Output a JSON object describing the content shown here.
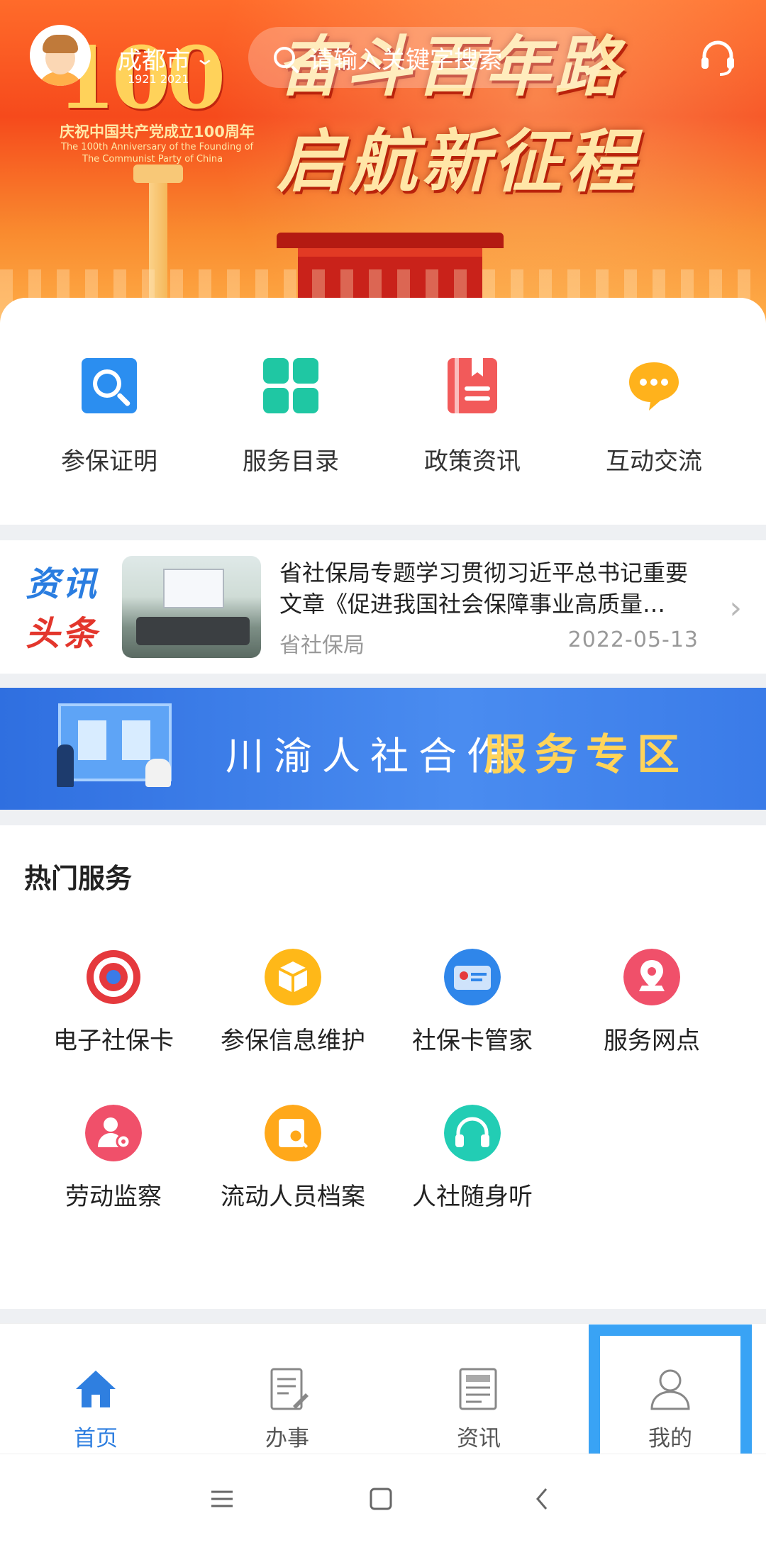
{
  "header": {
    "city": "成都市",
    "search_placeholder": "请输入关键字搜索",
    "slogan_line1": "奋斗百年路",
    "slogan_line2": "启航新征程",
    "logo": {
      "number": "100",
      "years": "1921   2021",
      "line1": "庆祝中国共产党成立100周年",
      "line2": "The 100th Anniversary of the Founding of",
      "line3": "The Communist Party of China"
    }
  },
  "quick_actions": [
    {
      "label": "参保证明",
      "icon": "search-doc-icon",
      "color": "#2b8ef0"
    },
    {
      "label": "服务目录",
      "icon": "grid-icon",
      "color": "#1fc7a3"
    },
    {
      "label": "政策资讯",
      "icon": "book-icon",
      "color": "#f25a5a"
    },
    {
      "label": "互动交流",
      "icon": "chat-icon",
      "color": "#ffb21c"
    }
  ],
  "news": {
    "tag_line1": "资讯",
    "tag_line2": "头条",
    "title": "省社保局专题学习贯彻习近平总书记重要文章《促进我国社会保障事业高质量…",
    "source": "省社保局",
    "date": "2022-05-13"
  },
  "promo": {
    "text_white": "川渝人社合作",
    "text_highlight": "服务专区"
  },
  "hot_services": {
    "title": "热门服务",
    "items": [
      {
        "label": "电子社保卡",
        "icon": "social-security-card-icon",
        "color": "#e5393d"
      },
      {
        "label": "参保信息维护",
        "icon": "box-icon",
        "color": "#ffb818"
      },
      {
        "label": "社保卡管家",
        "icon": "card-icon",
        "color": "#2f86ea"
      },
      {
        "label": "服务网点",
        "icon": "location-icon",
        "color": "#f0506a"
      },
      {
        "label": "劳动监察",
        "icon": "inspection-icon",
        "color": "#f0506a"
      },
      {
        "label": "流动人员档案",
        "icon": "archive-search-icon",
        "color": "#ffa81a"
      },
      {
        "label": "人社随身听",
        "icon": "headphones-icon",
        "color": "#22cdb4"
      }
    ]
  },
  "tabbar": {
    "items": [
      {
        "label": "首页",
        "icon": "home-icon",
        "active": true
      },
      {
        "label": "办事",
        "icon": "document-edit-icon",
        "active": false
      },
      {
        "label": "资讯",
        "icon": "newspaper-icon",
        "active": false
      },
      {
        "label": "我的",
        "icon": "user-icon",
        "active": false
      }
    ]
  },
  "colors": {
    "accent": "#2f7fe0",
    "highlight_box": "#39a3f5"
  }
}
